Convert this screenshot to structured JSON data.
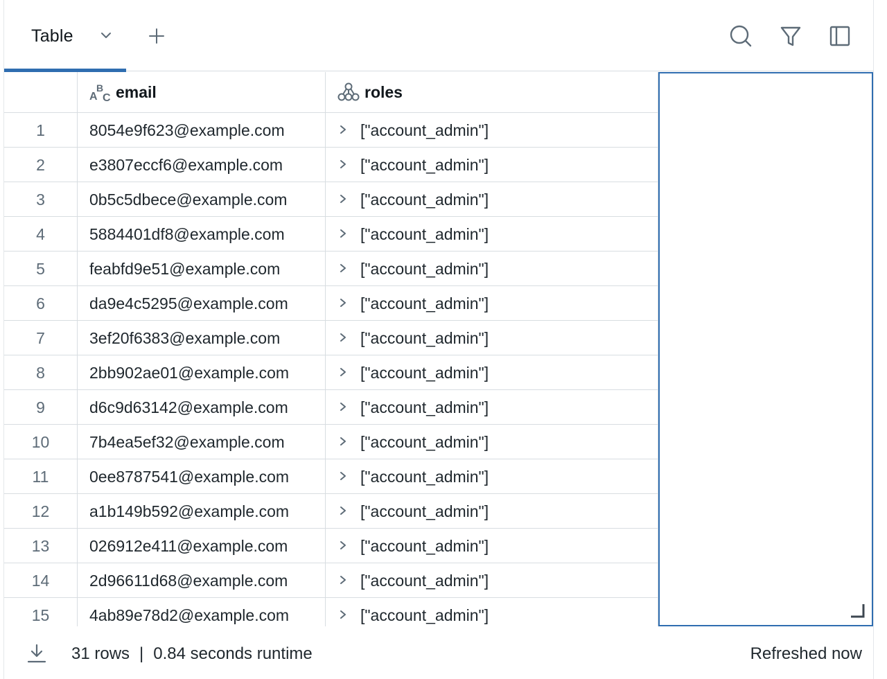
{
  "tabs": {
    "active_label": "Table"
  },
  "table": {
    "columns": [
      {
        "name": "email",
        "type_icon": "string-type-icon"
      },
      {
        "name": "roles",
        "type_icon": "struct-type-icon"
      }
    ],
    "rows": [
      {
        "index": "1",
        "email": "8054e9f623@example.com",
        "roles": "[\"account_admin\"]"
      },
      {
        "index": "2",
        "email": "e3807eccf6@example.com",
        "roles": "[\"account_admin\"]"
      },
      {
        "index": "3",
        "email": "0b5c5dbece@example.com",
        "roles": "[\"account_admin\"]"
      },
      {
        "index": "4",
        "email": "5884401df8@example.com",
        "roles": "[\"account_admin\"]"
      },
      {
        "index": "5",
        "email": "feabfd9e51@example.com",
        "roles": "[\"account_admin\"]"
      },
      {
        "index": "6",
        "email": "da9e4c5295@example.com",
        "roles": "[\"account_admin\"]"
      },
      {
        "index": "7",
        "email": "3ef20f6383@example.com",
        "roles": "[\"account_admin\"]"
      },
      {
        "index": "8",
        "email": "2bb902ae01@example.com",
        "roles": "[\"account_admin\"]"
      },
      {
        "index": "9",
        "email": "d6c9d63142@example.com",
        "roles": "[\"account_admin\"]"
      },
      {
        "index": "10",
        "email": "7b4ea5ef32@example.com",
        "roles": "[\"account_admin\"]"
      },
      {
        "index": "11",
        "email": "0ee8787541@example.com",
        "roles": "[\"account_admin\"]"
      },
      {
        "index": "12",
        "email": "a1b149b592@example.com",
        "roles": "[\"account_admin\"]"
      },
      {
        "index": "13",
        "email": "026912e411@example.com",
        "roles": "[\"account_admin\"]"
      },
      {
        "index": "14",
        "email": "2d96611d68@example.com",
        "roles": "[\"account_admin\"]"
      },
      {
        "index": "15",
        "email": "4ab89e78d2@example.com",
        "roles": "[\"account_admin\"]"
      }
    ]
  },
  "footer": {
    "row_count": "31 rows",
    "separator": "|",
    "runtime": "0.84 seconds runtime",
    "refreshed": "Refreshed now"
  },
  "colors": {
    "accent": "#2f6db0",
    "border": "#d8dde1",
    "muted": "#5d6b77"
  }
}
